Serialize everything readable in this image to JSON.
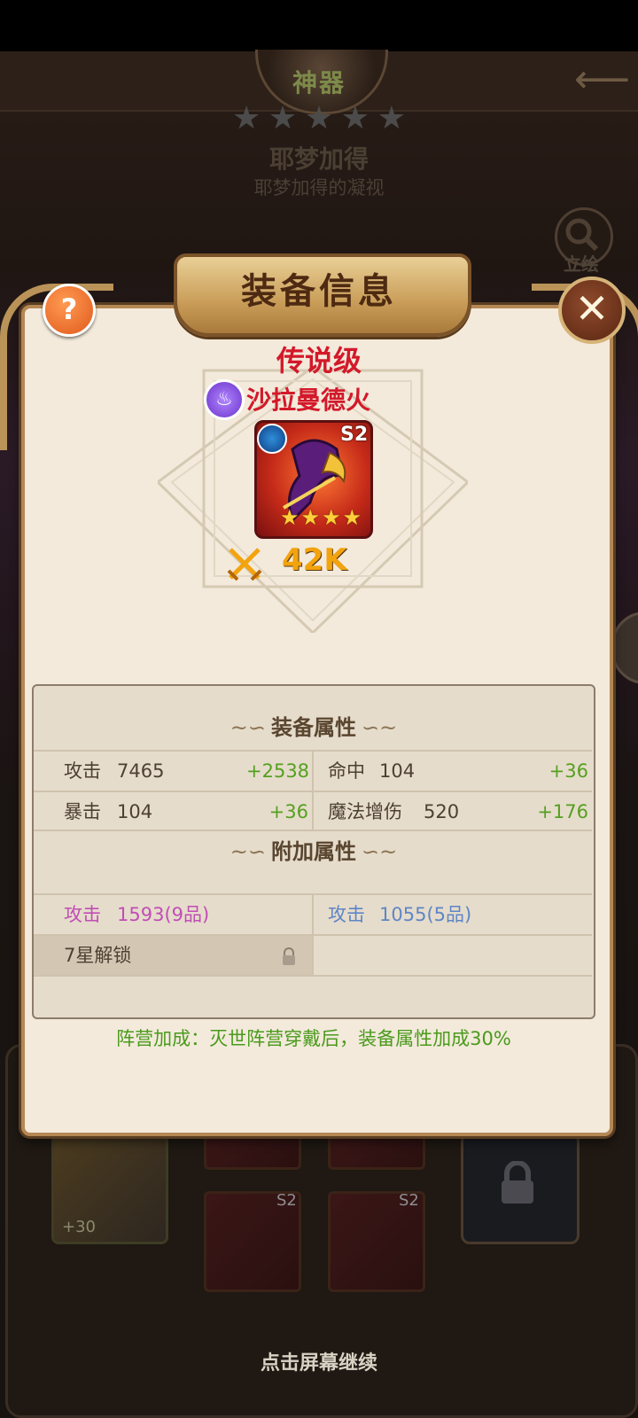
{
  "background": {
    "header_title": "神器",
    "stars": 5,
    "hero_name": "耶梦加得",
    "hero_subtitle": "耶梦加得的凝视",
    "portrait_label": "立绘",
    "slot_big_level": "+30",
    "slot_s2_a": "S2",
    "slot_s2_b": "S2",
    "continue_hint": "点击屏幕继续"
  },
  "modal": {
    "title": "装备信息",
    "help_glyph": "?",
    "close_glyph": "✕",
    "grade": "传说级",
    "equipment_name": "沙拉曼德火",
    "equipment_tier": "S2",
    "equipment_stars": 4,
    "power": "42K",
    "main_attr_heading": "装备属性",
    "main_attrs": [
      {
        "name": "攻击",
        "value": "7465",
        "bonus": "+2538"
      },
      {
        "name": "命中",
        "value": "104",
        "bonus": "+36"
      },
      {
        "name": "暴击",
        "value": "104",
        "bonus": "+36"
      },
      {
        "name": "魔法增伤",
        "value": "520",
        "bonus": "+176"
      }
    ],
    "extra_attr_heading": "附加属性",
    "extra_attrs": [
      {
        "name": "攻击",
        "value": "1593(9品)",
        "color": "#c04eb6"
      },
      {
        "name": "攻击",
        "value": "1055(5品)",
        "color": "#5e86c7"
      }
    ],
    "locked_slot": "7星解锁",
    "faction_bonus": "阵营加成：灭世阵营穿戴后，装备属性加成30%"
  },
  "colors": {
    "grade_red": "#d3192a",
    "bonus_green": "#54a020",
    "power_gold": "#f2a30e"
  }
}
